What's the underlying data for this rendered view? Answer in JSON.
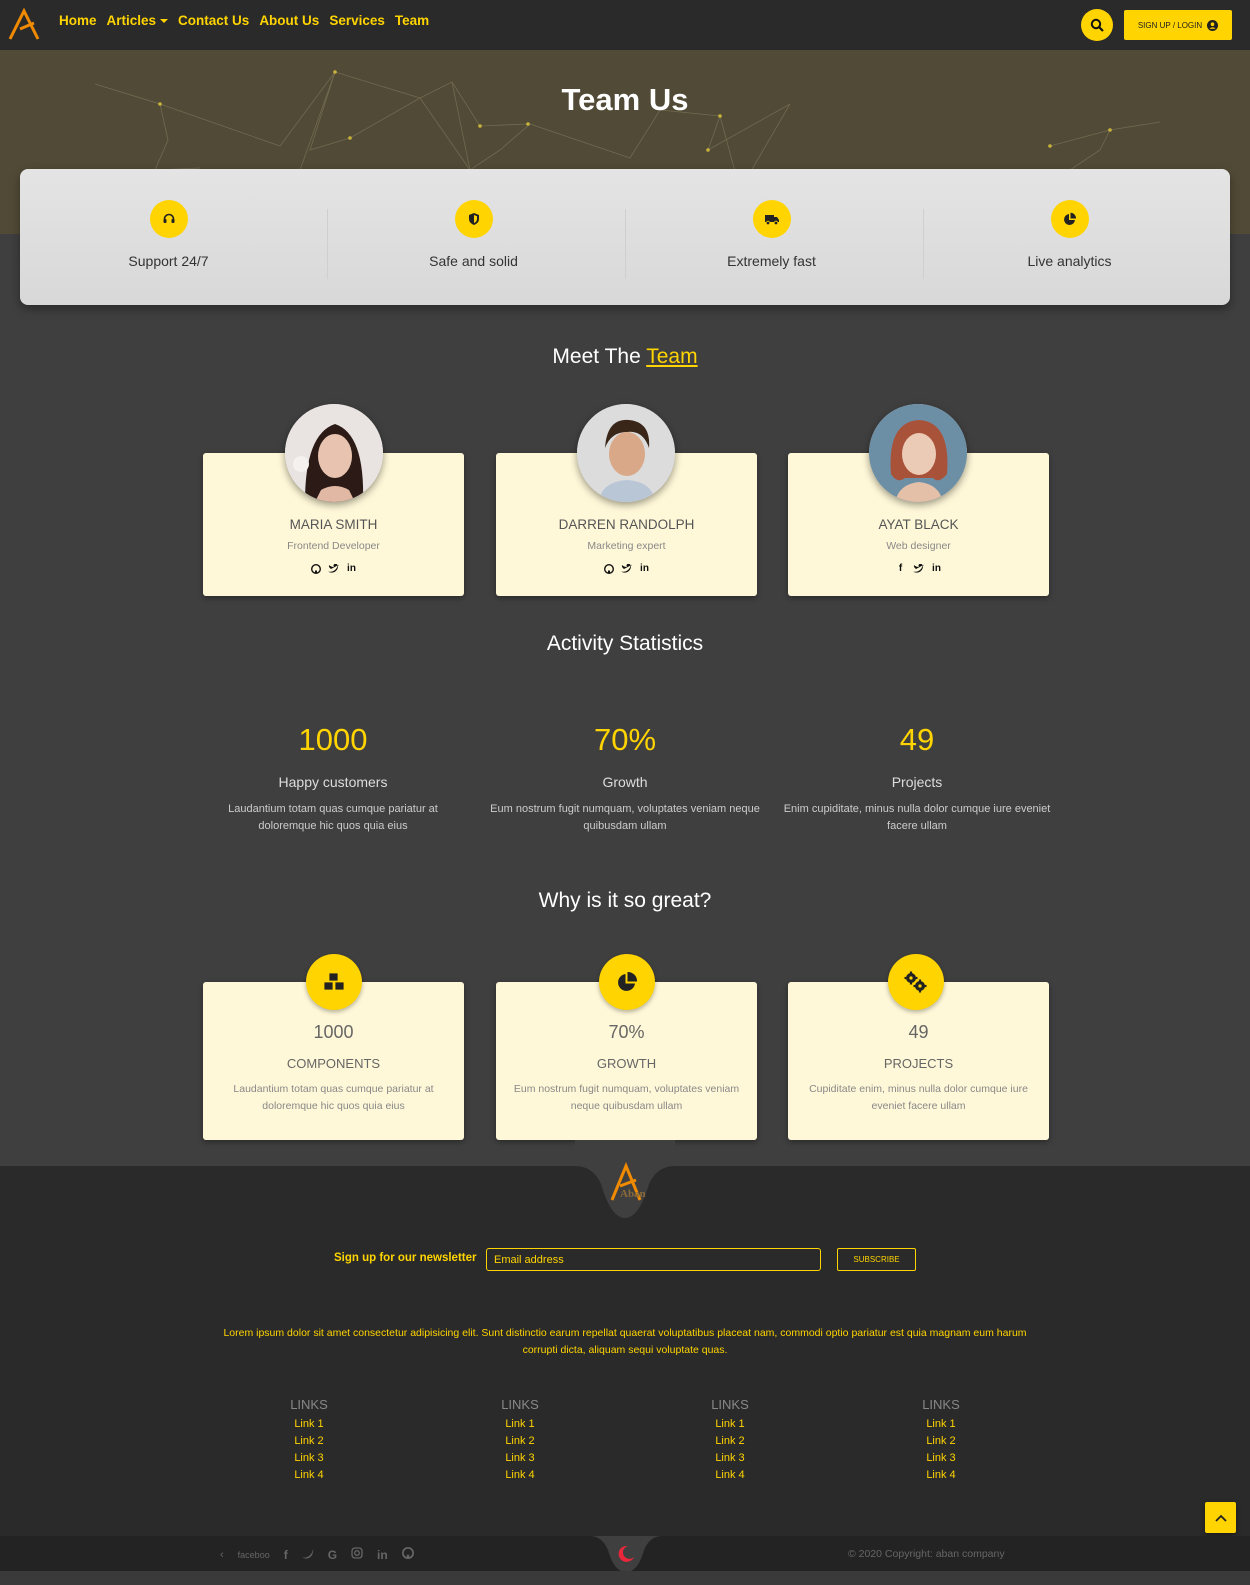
{
  "nav": {
    "links": [
      "Home",
      "Articles",
      "Contact Us",
      "About Us",
      "Services",
      "Team"
    ],
    "signup_label": "SIGN UP / LOGIN",
    "accent": "#ffd400"
  },
  "hero": {
    "title": "Team Us"
  },
  "features": [
    {
      "label": "Support 24/7",
      "icon": "headset-icon"
    },
    {
      "label": "Safe and solid",
      "icon": "shield-icon"
    },
    {
      "label": "Extremely fast",
      "icon": "truck-icon"
    },
    {
      "label": "Live analytics",
      "icon": "pie-chart-icon"
    }
  ],
  "team_section": {
    "title_prefix": "Meet The",
    "title_accent": "Team"
  },
  "team": [
    {
      "name": "MARIA SMITH",
      "role": "Frontend Developer",
      "socials": [
        "github",
        "twitter",
        "in"
      ]
    },
    {
      "name": "DARREN RANDOLPH",
      "role": "Marketing expert",
      "socials": [
        "github",
        "twitter",
        "in"
      ]
    },
    {
      "name": "AYAT BLACK",
      "role": "Web designer",
      "socials": [
        "facebook",
        "twitter",
        "in"
      ]
    }
  ],
  "stats_section": {
    "title": "Activity Statistics"
  },
  "stats": [
    {
      "value": "1000",
      "label": "Happy customers",
      "desc": "Laudantium totam quas cumque pariatur at doloremque hic quos quia eius"
    },
    {
      "value": "70%",
      "label": "Growth",
      "desc": "Eum nostrum fugit numquam, voluptates veniam neque quibusdam ullam"
    },
    {
      "value": "49",
      "label": "Projects",
      "desc": "Enim cupiditate, minus nulla dolor cumque iure eveniet facere ullam"
    }
  ],
  "why_section": {
    "title": "Why is it so great?"
  },
  "why": [
    {
      "value": "1000",
      "label": "COMPONENTS",
      "desc": "Laudantium totam quas cumque pariatur at doloremque hic quos quia eius",
      "icon": "cubes-icon"
    },
    {
      "value": "70%",
      "label": "GROWTH",
      "desc": "Eum nostrum fugit numquam, voluptates veniam neque quibusdam ullam",
      "icon": "pie-chart-icon"
    },
    {
      "value": "49",
      "label": "PROJECTS",
      "desc": "Cupiditate enim, minus nulla dolor cumque iure eveniet facere ullam",
      "icon": "cogs-icon"
    }
  ],
  "footer": {
    "logo_text": "Aban",
    "newsletter_label": "Sign up for our newsletter",
    "email_placeholder": "Email address",
    "subscribe_label": "SUBSCRIBE",
    "text": "Lorem ipsum dolor sit amet consectetur adipisicing elit. Sunt distinctio earum repellat quaerat voluptatibus placeat nam, commodi optio pariatur est quia magnam eum harum corrupti dicta, aliquam sequi voluptate quas.",
    "link_columns": [
      {
        "title": "LINKS",
        "links": [
          "Link 1",
          "Link 2",
          "Link 3",
          "Link 4"
        ]
      },
      {
        "title": "LINKS",
        "links": [
          "Link 1",
          "Link 2",
          "Link 3",
          "Link 4"
        ]
      },
      {
        "title": "LINKS",
        "links": [
          "Link 1",
          "Link 2",
          "Link 3",
          "Link 4"
        ]
      },
      {
        "title": "LINKS",
        "links": [
          "Link 1",
          "Link 2",
          "Link 3",
          "Link 4"
        ]
      }
    ],
    "social_text": "faceboo",
    "copyright": "© 2020 Copyright: aban company"
  }
}
